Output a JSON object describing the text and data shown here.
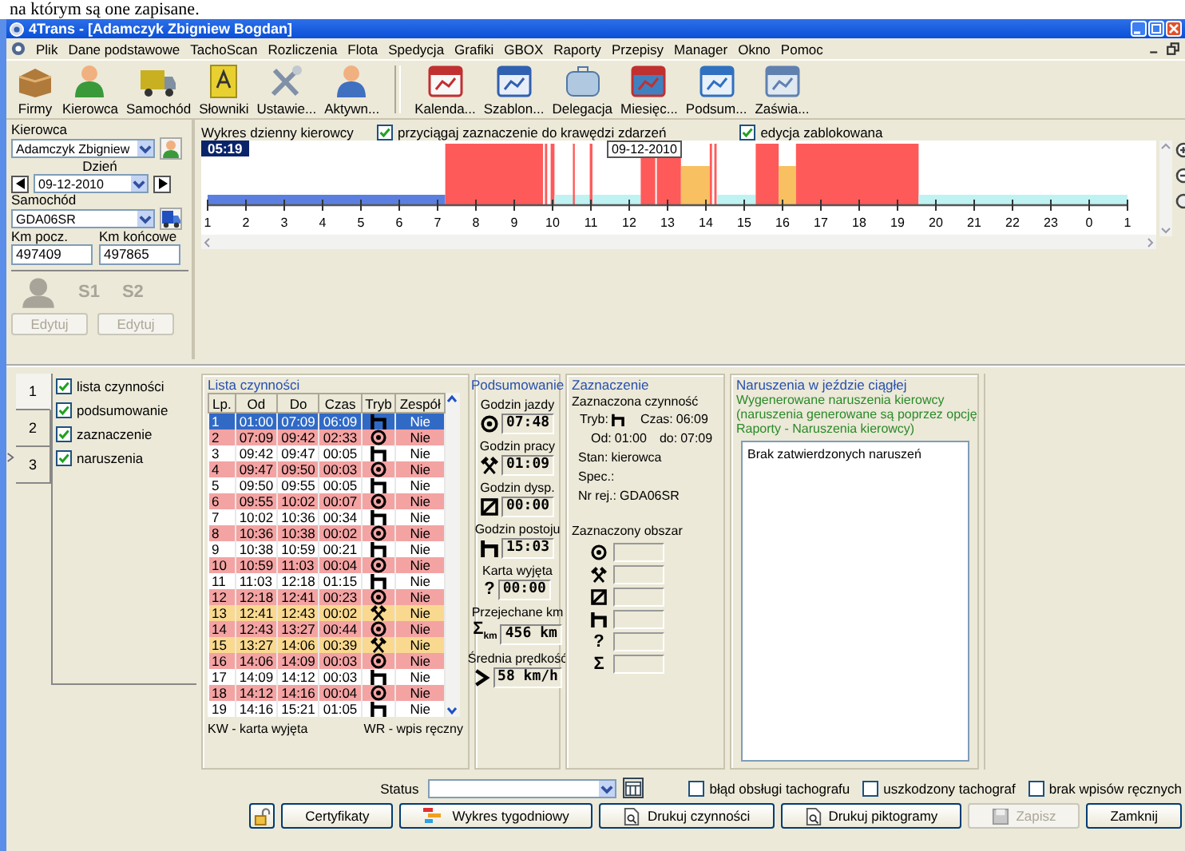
{
  "document_text": "na którym są one zapisane.",
  "window": {
    "title": "4Trans - [Adamczyk Zbigniew Bogdan]"
  },
  "menu": [
    "Plik",
    "Dane podstawowe",
    "TachoScan",
    "Rozliczenia",
    "Flota",
    "Spedycja",
    "Grafiki",
    "GBOX",
    "Raporty",
    "Przepisy",
    "Manager",
    "Okno",
    "Pomoc"
  ],
  "toolbar_groups": [
    [
      {
        "label": "Firmy",
        "kind": "box"
      },
      {
        "label": "Kierowca",
        "kind": "person"
      },
      {
        "label": "Samochód",
        "kind": "truck"
      },
      {
        "label": "Słowniki",
        "kind": "book"
      },
      {
        "label": "Ustawie...",
        "kind": "tools"
      },
      {
        "label": "Aktywn...",
        "kind": "user"
      }
    ],
    [
      {
        "label": "Kalenda...",
        "kind": "calendar"
      },
      {
        "label": "Szablon...",
        "kind": "template"
      },
      {
        "label": "Delegacja",
        "kind": "briefcase"
      },
      {
        "label": "Miesięc...",
        "kind": "month"
      },
      {
        "label": "Podsum...",
        "kind": "summary"
      },
      {
        "label": "Zaświa...",
        "kind": "certificate"
      }
    ]
  ],
  "driver_panel": {
    "driver_label": "Kierowca",
    "driver": "Adamczyk Zbigniew",
    "day_label": "Dzień",
    "day": "09-12-2010",
    "vehicle_label": "Samochód",
    "vehicle": "GDA06SR",
    "km_start_label": "Km pocz.",
    "km_start": "497409",
    "km_end_label": "Km końcowe",
    "km_end": "497865",
    "slots": [
      "S1",
      "S2"
    ],
    "edit_buttons": [
      {
        "label": "Edytuj",
        "disabled": true
      },
      {
        "label": "Edytuj",
        "disabled": true
      }
    ]
  },
  "chart_header": {
    "title": "Wykres dzienny kierowcy",
    "options": [
      {
        "label": "przyciągaj zaznaczenie do krawędzi zdarzeń",
        "checked": true
      },
      {
        "label": "edycja zablokowana",
        "checked": true
      }
    ],
    "time": "05:19",
    "date_tooltip": "09-12-2010",
    "hour_labels": [
      "1",
      "2",
      "3",
      "4",
      "5",
      "6",
      "7",
      "8",
      "9",
      "10",
      "11",
      "12",
      "13",
      "14",
      "15",
      "16",
      "17",
      "18",
      "19",
      "20",
      "21",
      "22",
      "23",
      "0",
      "1"
    ]
  },
  "side_tabs": [
    {
      "label": "1",
      "selected": true
    },
    {
      "label": "2",
      "selected": false
    },
    {
      "label": "3",
      "selected": false
    }
  ],
  "sections": [
    {
      "label": "lista czynności",
      "checked": true
    },
    {
      "label": "podsumowanie",
      "checked": true
    },
    {
      "label": "zaznaczenie",
      "checked": true
    },
    {
      "label": "naruszenia",
      "checked": true
    }
  ],
  "activity_list": {
    "title": "Lista czynności",
    "columns": [
      "Lp.",
      "Od",
      "Do",
      "Czas",
      "Tryb",
      "Zespół"
    ],
    "rows": [
      {
        "lp": "1",
        "od": "01:00",
        "do": "07:09",
        "czas": "06:09",
        "kind": "rest",
        "team": "Nie",
        "selected": true
      },
      {
        "lp": "2",
        "od": "07:09",
        "do": "09:42",
        "czas": "02:33",
        "kind": "drive",
        "team": "Nie",
        "selected": false
      },
      {
        "lp": "3",
        "od": "09:42",
        "do": "09:47",
        "czas": "00:05",
        "kind": "rest",
        "team": "Nie",
        "selected": false
      },
      {
        "lp": "4",
        "od": "09:47",
        "do": "09:50",
        "czas": "00:03",
        "kind": "drive",
        "team": "Nie",
        "selected": false
      },
      {
        "lp": "5",
        "od": "09:50",
        "do": "09:55",
        "czas": "00:05",
        "kind": "rest",
        "team": "Nie",
        "selected": false
      },
      {
        "lp": "6",
        "od": "09:55",
        "do": "10:02",
        "czas": "00:07",
        "kind": "drive",
        "team": "Nie",
        "selected": false
      },
      {
        "lp": "7",
        "od": "10:02",
        "do": "10:36",
        "czas": "00:34",
        "kind": "rest",
        "team": "Nie",
        "selected": false
      },
      {
        "lp": "8",
        "od": "10:36",
        "do": "10:38",
        "czas": "00:02",
        "kind": "drive",
        "team": "Nie",
        "selected": false
      },
      {
        "lp": "9",
        "od": "10:38",
        "do": "10:59",
        "czas": "00:21",
        "kind": "rest",
        "team": "Nie",
        "selected": false
      },
      {
        "lp": "10",
        "od": "10:59",
        "do": "11:03",
        "czas": "00:04",
        "kind": "drive",
        "team": "Nie",
        "selected": false
      },
      {
        "lp": "11",
        "od": "11:03",
        "do": "12:18",
        "czas": "01:15",
        "kind": "rest",
        "team": "Nie",
        "selected": false
      },
      {
        "lp": "12",
        "od": "12:18",
        "do": "12:41",
        "czas": "00:23",
        "kind": "drive",
        "team": "Nie",
        "selected": false
      },
      {
        "lp": "13",
        "od": "12:41",
        "do": "12:43",
        "czas": "00:02",
        "kind": "work",
        "team": "Nie",
        "selected": false
      },
      {
        "lp": "14",
        "od": "12:43",
        "do": "13:27",
        "czas": "00:44",
        "kind": "drive",
        "team": "Nie",
        "selected": false
      },
      {
        "lp": "15",
        "od": "13:27",
        "do": "14:06",
        "czas": "00:39",
        "kind": "work",
        "team": "Nie",
        "selected": false
      },
      {
        "lp": "16",
        "od": "14:06",
        "do": "14:09",
        "czas": "00:03",
        "kind": "drive",
        "team": "Nie",
        "selected": false
      },
      {
        "lp": "17",
        "od": "14:09",
        "do": "14:12",
        "czas": "00:03",
        "kind": "rest",
        "team": "Nie",
        "selected": false
      },
      {
        "lp": "18",
        "od": "14:12",
        "do": "14:16",
        "czas": "00:04",
        "kind": "drive",
        "team": "Nie",
        "selected": false
      },
      {
        "lp": "19",
        "od": "14:16",
        "do": "15:21",
        "czas": "01:05",
        "kind": "rest",
        "team": "Nie",
        "selected": false
      }
    ],
    "legend": [
      "KW - karta wyjęta",
      "WR - wpis ręczny"
    ]
  },
  "summary": {
    "title": "Podsumowanie",
    "items": [
      {
        "label": "Godzin jazdy",
        "kind": "drive",
        "value": "07:48"
      },
      {
        "label": "Godzin pracy",
        "kind": "work",
        "value": "01:09"
      },
      {
        "label": "Godzin dysp.",
        "kind": "availability",
        "value": "00:00"
      },
      {
        "label": "Godzin postoju",
        "kind": "rest",
        "value": "15:03"
      },
      {
        "label": "Karta wyjęta",
        "kind": "symbol",
        "symbol": "?",
        "value": "00:00"
      },
      {
        "label": "Przejechane km",
        "kind": "symbol",
        "symbol": "Σ",
        "sub": "km",
        "value": "456 km"
      },
      {
        "label": "Średnia prędkość",
        "kind": "speed",
        "value": "58 km/h"
      }
    ]
  },
  "selection": {
    "title": "Zaznaczenie",
    "subtitle": "Zaznaczona czynność",
    "mode_label": "Tryb:",
    "mode": {
      "kind": "rest"
    },
    "time_label": "Czas:",
    "time": "06:09",
    "from_label": "Od:",
    "from": "01:00",
    "to_label": "do:",
    "to": "07:09",
    "fields": [
      {
        "label": "Stan:",
        "value": "kierowca"
      },
      {
        "label": "Spec.:"
      },
      {
        "label": "Nr rej.:",
        "value": "GDA06SR"
      }
    ],
    "area_title": "Zaznaczony obszar",
    "area_rows": [
      {
        "kind": "drive"
      },
      {
        "kind": "work"
      },
      {
        "kind": "availability"
      },
      {
        "kind": "rest"
      },
      {
        "kind": "symbol",
        "symbol": "?"
      },
      {
        "kind": "symbol",
        "symbol": "Σ"
      }
    ]
  },
  "violations": {
    "title": "Naruszenia w jeździe ciągłej",
    "note": [
      "Wygenerowane naruszenia kierowcy",
      "(naruszenia generowane są poprzez opcję",
      "Raporty - Naruszenia kierowcy)"
    ],
    "items": [
      "Brak zatwierdzonych naruszeń"
    ]
  },
  "footer": {
    "status_label": "Status",
    "flags": [
      {
        "label": "błąd obsługi tachografu",
        "checked": false
      },
      {
        "label": "uszkodzony tachograf",
        "checked": false
      },
      {
        "label": "brak wpisów ręcznych",
        "checked": false
      }
    ],
    "buttons": [
      {
        "label": "Certyfikaty",
        "kind": "plain",
        "disabled": false
      },
      {
        "label": "Wykres tygodniowy",
        "kind": "chart",
        "disabled": false
      },
      {
        "label": "Drukuj czynności",
        "kind": "print",
        "disabled": false
      },
      {
        "label": "Drukuj piktogramy",
        "kind": "print",
        "disabled": false
      },
      {
        "label": "Zapisz",
        "kind": "save",
        "disabled": true
      },
      {
        "label": "Zamknij",
        "kind": "plain",
        "disabled": false
      }
    ]
  }
}
